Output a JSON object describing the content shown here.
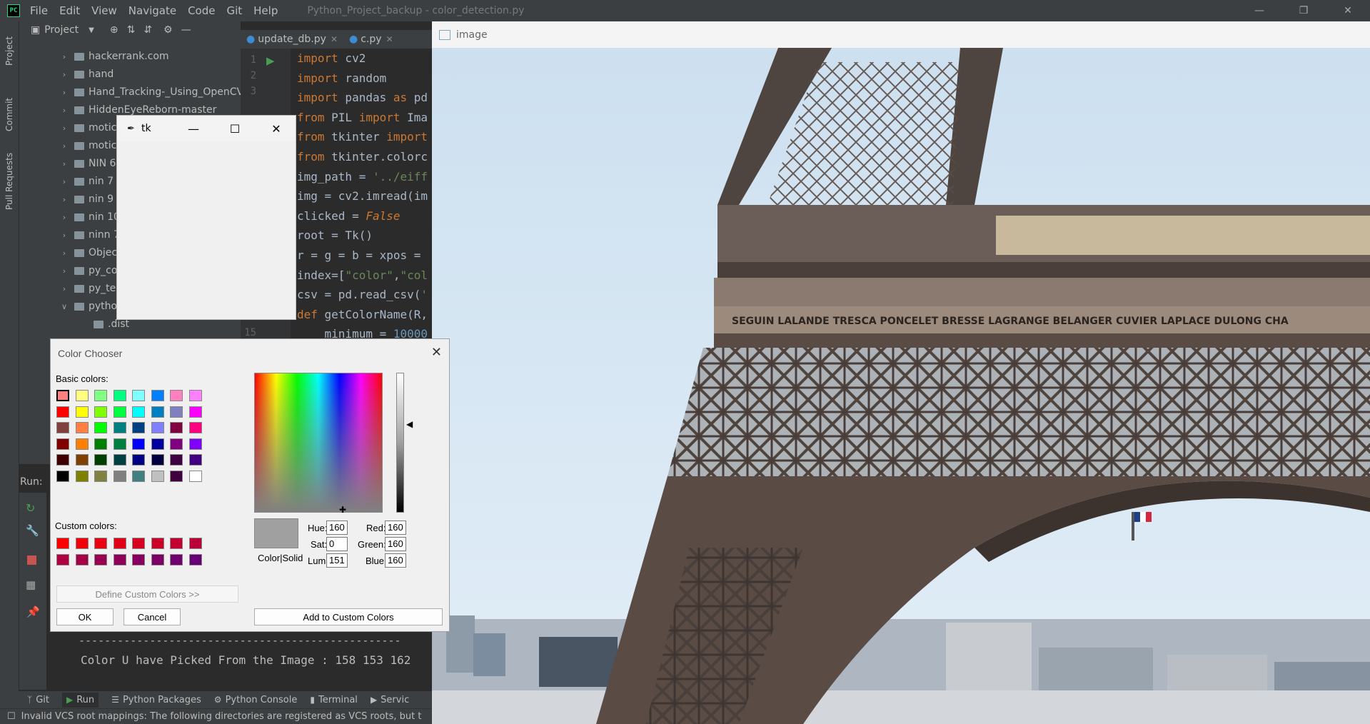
{
  "ide": {
    "window_title": "Python_Project_backup - color_detection.py",
    "menu": [
      "File",
      "Edit",
      "View",
      "Navigate",
      "Code",
      "Git",
      "Help"
    ],
    "left_tabs": [
      "Project",
      "Commit",
      "Pull Requests"
    ],
    "project_header": "Project",
    "tree": [
      "hackerrank.com",
      "hand",
      "Hand_Tracking-_Using_OpenCV",
      "HiddenEyeReborn-master",
      "motic",
      "motic",
      "NIN 6",
      "nin 7",
      "nin 9",
      "nin 10",
      "ninn 7",
      "Objec",
      "py_co",
      "py_te",
      "pytho",
      ".dist"
    ],
    "tabs": [
      "update_db.py",
      "c.py"
    ],
    "line_numbers": [
      "1",
      "2",
      "3",
      "15"
    ],
    "code_lines": [
      "import cv2",
      "import random",
      "import pandas as pd",
      "from PIL import Ima",
      "from tkinter import",
      "from tkinter.colorc",
      "img_path = '../eiff",
      "img = cv2.imread(im",
      "clicked = False",
      "root = Tk()",
      "r = g = b = xpos = ",
      "index=[\"color\",\"col",
      "csv = pd.read_csv('",
      "def getColorName(R,",
      "    minimum = 10000"
    ],
    "run_label": "Run:",
    "console_divider": "--------------------------------------------------",
    "console_output": "Color U have Picked From the Image : 158 153 162",
    "bottom_tools": [
      "Git",
      "Run",
      "Python Packages",
      "Python Console",
      "Terminal",
      "Servic"
    ],
    "status_text": "Invalid VCS root mappings: The following directories are registered as VCS roots, but t"
  },
  "image_window": {
    "title": "image"
  },
  "photo_text": "SEGUIN   LALANDE   TRESCA   PONCELET   BRESSE   LAGRANGE   BELANGER   CUVIER   LAPLACE   DULONG   CHA",
  "tk_window": {
    "title": "tk"
  },
  "color_chooser": {
    "title": "Color Chooser",
    "basic_label": "Basic colors:",
    "custom_label": "Custom colors:",
    "define_button": "Define Custom Colors >>",
    "ok_button": "OK",
    "cancel_button": "Cancel",
    "add_button": "Add to Custom Colors",
    "color_solid_label": "Color|Solid",
    "hue_label": "Hue:",
    "hue": "160",
    "sat_label": "Sat:",
    "sat": "0",
    "lum_label": "Lum:",
    "lum": "151",
    "red_label": "Red:",
    "red": "160",
    "green_label": "Green:",
    "green": "160",
    "blue_label": "Blue:",
    "blue": "160",
    "selected_color": "#a0a0a0",
    "basic_colors": [
      "#ff8080",
      "#ffff80",
      "#80ff80",
      "#00ff80",
      "#80ffff",
      "#0080ff",
      "#ff80c0",
      "#ff80ff",
      "#ff0000",
      "#ffff00",
      "#80ff00",
      "#00ff40",
      "#00ffff",
      "#0080c0",
      "#8080c0",
      "#ff00ff",
      "#804040",
      "#ff8040",
      "#00ff00",
      "#008080",
      "#004080",
      "#8080ff",
      "#800040",
      "#ff0080",
      "#800000",
      "#ff8000",
      "#008000",
      "#008040",
      "#0000ff",
      "#0000a0",
      "#800080",
      "#8000ff",
      "#400000",
      "#804000",
      "#004000",
      "#004040",
      "#000080",
      "#000040",
      "#400040",
      "#400080",
      "#000000",
      "#808000",
      "#808040",
      "#808080",
      "#408080",
      "#c0c0c0",
      "#400040",
      "#ffffff"
    ],
    "custom_colors": [
      "#ff0000",
      "#f50008",
      "#eb0010",
      "#e10018",
      "#d70020",
      "#cd0028",
      "#c30030",
      "#b90038",
      "#af0040",
      "#a50048",
      "#9b0050",
      "#910058",
      "#870060",
      "#7d0068",
      "#730070",
      "#690078"
    ]
  }
}
